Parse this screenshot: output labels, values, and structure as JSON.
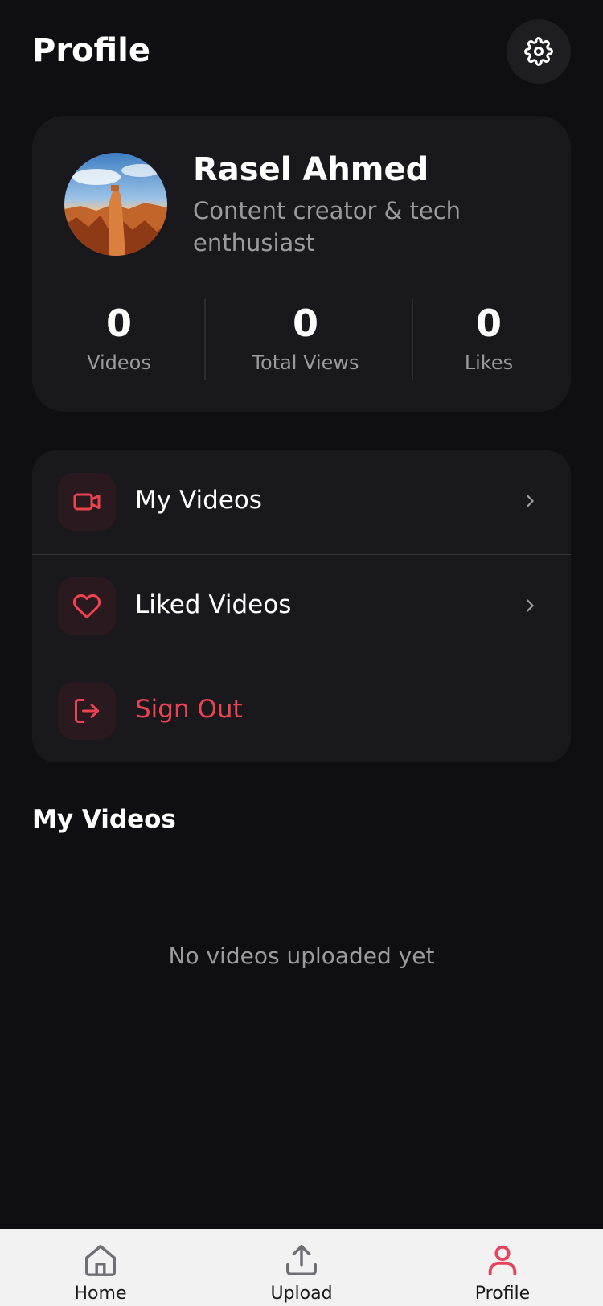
{
  "header": {
    "title": "Profile",
    "settings_icon": "gear-icon"
  },
  "profile": {
    "name": "Rasel Ahmed",
    "bio": "Content creator & tech enthusiast",
    "stats": [
      {
        "value": "0",
        "label": "Videos"
      },
      {
        "value": "0",
        "label": "Total Views"
      },
      {
        "value": "0",
        "label": "Likes"
      }
    ]
  },
  "menu": {
    "items": [
      {
        "label": "My Videos",
        "icon": "video-camera-icon"
      },
      {
        "label": "Liked Videos",
        "icon": "heart-icon"
      },
      {
        "label": "Sign Out",
        "icon": "sign-out-icon"
      }
    ]
  },
  "videos_section": {
    "title": "My Videos",
    "empty_message": "No videos uploaded yet"
  },
  "tabbar": {
    "tabs": [
      {
        "label": "Home",
        "icon": "home-icon"
      },
      {
        "label": "Upload",
        "icon": "upload-icon"
      },
      {
        "label": "Profile",
        "icon": "user-icon"
      }
    ],
    "active_tab": "Profile"
  },
  "colors": {
    "background": "#0e0e13",
    "card": "#18181d",
    "accent": "#ec4350",
    "muted_text": "#9a9aa0",
    "active_tab": "#e8415a"
  }
}
